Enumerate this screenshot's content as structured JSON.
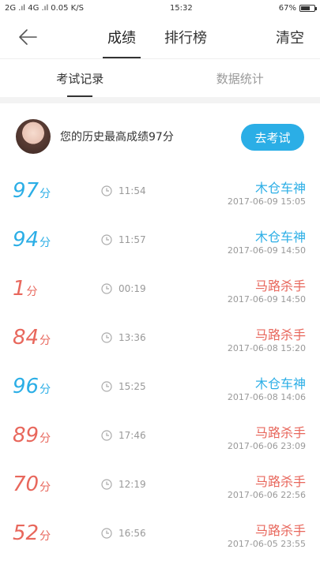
{
  "status_bar": {
    "signal_text": "2G .ıl 4G .ıl",
    "network_speed": "0.05 K/S",
    "time": "15:32",
    "battery": "67%",
    "battery_level": 0.67
  },
  "header": {
    "back_icon": "back-arrow-icon",
    "tabs": [
      {
        "label": "成绩",
        "active": true
      },
      {
        "label": "排行榜",
        "active": false
      }
    ],
    "clear_label": "清空"
  },
  "subtabs": [
    {
      "label": "考试记录",
      "active": true
    },
    {
      "label": "数据统计",
      "active": false
    }
  ],
  "summary": {
    "text": "您的历史最高成绩97分",
    "button_label": "去考试"
  },
  "colors": {
    "blue": "#2baee6",
    "red": "#e8675c"
  },
  "records": [
    {
      "score": "97",
      "unit": "分",
      "duration": "11:54",
      "title": "木仓车神",
      "date": "2017-06-09 15:05",
      "color": "blue"
    },
    {
      "score": "94",
      "unit": "分",
      "duration": "11:57",
      "title": "木仓车神",
      "date": "2017-06-09 14:50",
      "color": "blue"
    },
    {
      "score": "1",
      "unit": "分",
      "duration": "00:19",
      "title": "马路杀手",
      "date": "2017-06-09 14:50",
      "color": "red"
    },
    {
      "score": "84",
      "unit": "分",
      "duration": "13:36",
      "title": "马路杀手",
      "date": "2017-06-08 15:20",
      "color": "red"
    },
    {
      "score": "96",
      "unit": "分",
      "duration": "15:25",
      "title": "木仓车神",
      "date": "2017-06-08 14:06",
      "color": "blue"
    },
    {
      "score": "89",
      "unit": "分",
      "duration": "17:46",
      "title": "马路杀手",
      "date": "2017-06-06 23:09",
      "color": "red"
    },
    {
      "score": "70",
      "unit": "分",
      "duration": "12:19",
      "title": "马路杀手",
      "date": "2017-06-06 22:56",
      "color": "red"
    },
    {
      "score": "52",
      "unit": "分",
      "duration": "16:56",
      "title": "马路杀手",
      "date": "2017-06-05 23:55",
      "color": "red"
    }
  ]
}
